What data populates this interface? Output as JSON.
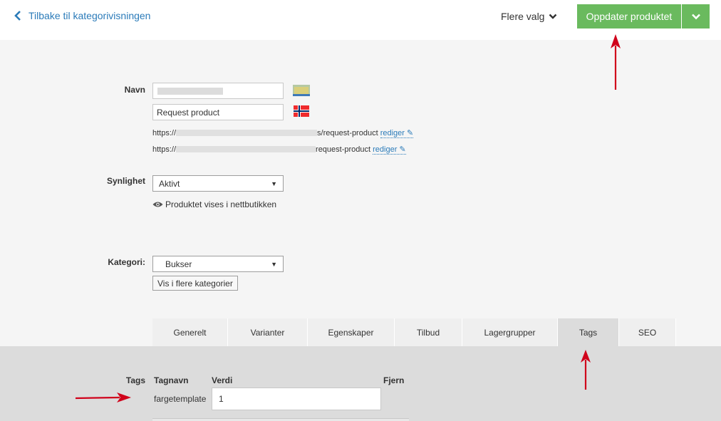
{
  "header": {
    "back_label": "Tilbake til kategorivisningen",
    "more_options_label": "Flere valg",
    "update_label": "Oppdater produktet"
  },
  "form": {
    "name": {
      "label": "Navn",
      "value_secondary": "Request product",
      "url1_prefix": "https://",
      "url1_suffix": "s/request-product",
      "url2_prefix": "https://",
      "url2_suffix": "request-product",
      "edit_label": "rediger ✎"
    },
    "visibility": {
      "label": "Synlighet",
      "selected": "Aktivt",
      "note": "Produktet vises i nettbutikken"
    },
    "category": {
      "label": "Kategori:",
      "selected": "Bukser",
      "more_button": "Vis i flere kategorier"
    }
  },
  "tabs": [
    {
      "label": "Generelt"
    },
    {
      "label": "Varianter"
    },
    {
      "label": "Egenskaper"
    },
    {
      "label": "Tilbud"
    },
    {
      "label": "Lagergrupper"
    },
    {
      "label": "Tags"
    },
    {
      "label": "SEO"
    }
  ],
  "tags_panel": {
    "label": "Tags",
    "col_name": "Tagnavn",
    "col_value": "Verdi",
    "col_remove": "Fjern",
    "rows": [
      {
        "name": "fargetemplate",
        "value": "1"
      }
    ]
  },
  "colors": {
    "accent_green": "#6aba5e",
    "link_blue": "#2b7bb9",
    "annotation_red": "#d0021b"
  }
}
